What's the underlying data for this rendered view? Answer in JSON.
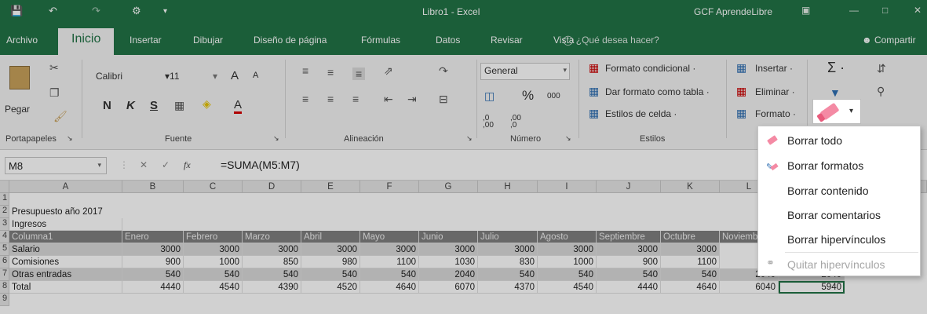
{
  "titlebar": {
    "title": "Libro1  -  Excel",
    "user": "GCF AprendeLibre",
    "icons": [
      "save-icon",
      "undo-icon",
      "redo-icon",
      "customize-icon"
    ],
    "colors": {
      "excel_green": "#217346"
    }
  },
  "tabs": [
    "Archivo",
    "Inicio",
    "Insertar",
    "Dibujar",
    "Diseño de página",
    "Fórmulas",
    "Datos",
    "Revisar",
    "Vista"
  ],
  "tellme": "¿Qué desea hacer?",
  "share": "Compartir",
  "ribbon": {
    "clipboard": {
      "paste": "Pegar",
      "label": "Portapapeles"
    },
    "font": {
      "name": "Calibri",
      "size": "11",
      "bold": "N",
      "italic": "K",
      "underline": "S",
      "grow": "A",
      "shrink": "A",
      "color": "A",
      "label": "Fuente"
    },
    "alignment": {
      "label": "Alineación"
    },
    "number": {
      "format": "General",
      "percent": "%",
      "thousands": "000",
      "inc_dec": ",0 ,00",
      "dec_dec": ",00 ,0",
      "label": "Número"
    },
    "styles": {
      "conditional": "Formato condicional ·",
      "as_table": "Dar formato como tabla ·",
      "cell_styles": "Estilos de celda ·",
      "label": "Estilos"
    },
    "cells": {
      "insert": "Insertar ·",
      "delete": "Eliminar ·",
      "format": "Formato ·"
    },
    "editing": {
      "sum": "Σ ·"
    }
  },
  "formula_bar": {
    "name_box": "M8",
    "cancel": "✕",
    "enter": "✓",
    "fx": "fx",
    "formula": "=SUMA(M5:M7)"
  },
  "sheet": {
    "columns": [
      "A",
      "B",
      "C",
      "D",
      "E",
      "F",
      "G",
      "H",
      "I",
      "J",
      "K",
      "L"
    ],
    "row_numbers": [
      "1",
      "2",
      "3",
      "4",
      "5",
      "6",
      "7",
      "8",
      "9"
    ],
    "a2": "Presupuesto año 2017",
    "a3": "Ingresos",
    "header_row": [
      "Columna1",
      "Enero",
      "Febrero",
      "Marzo",
      "Abril",
      "Mayo",
      "Junio",
      "Julio",
      "Agosto",
      "Septiembre",
      "Octubre",
      "Noviemb"
    ],
    "rows": [
      {
        "label": "Salario",
        "values": [
          "3000",
          "3000",
          "3000",
          "3000",
          "3000",
          "3000",
          "3000",
          "3000",
          "3000",
          "3000"
        ]
      },
      {
        "label": "Comisiones",
        "values": [
          "900",
          "1000",
          "850",
          "980",
          "1100",
          "1030",
          "830",
          "1000",
          "900",
          "1100"
        ]
      },
      {
        "label": "Otras entradas",
        "values": [
          "540",
          "540",
          "540",
          "540",
          "540",
          "2040",
          "540",
          "540",
          "540",
          "540",
          "2040",
          "2040"
        ]
      },
      {
        "label": "Total",
        "values": [
          "4440",
          "4540",
          "4390",
          "4520",
          "4640",
          "6070",
          "4370",
          "4540",
          "4440",
          "4640",
          "6040",
          "5940"
        ]
      }
    ]
  },
  "clear_menu": {
    "items": [
      {
        "label": "Borrar todo",
        "icon": "eraser-icon",
        "disabled": false
      },
      {
        "label": "Borrar formatos",
        "icon": "clear-formats-icon",
        "disabled": false
      },
      {
        "label": "Borrar contenido",
        "icon": "",
        "disabled": false
      },
      {
        "label": "Borrar comentarios",
        "icon": "",
        "disabled": false
      },
      {
        "label": "Borrar hipervínculos",
        "icon": "",
        "disabled": false
      },
      {
        "label": "Quitar hipervínculos",
        "icon": "remove-link-icon",
        "disabled": true
      }
    ]
  }
}
